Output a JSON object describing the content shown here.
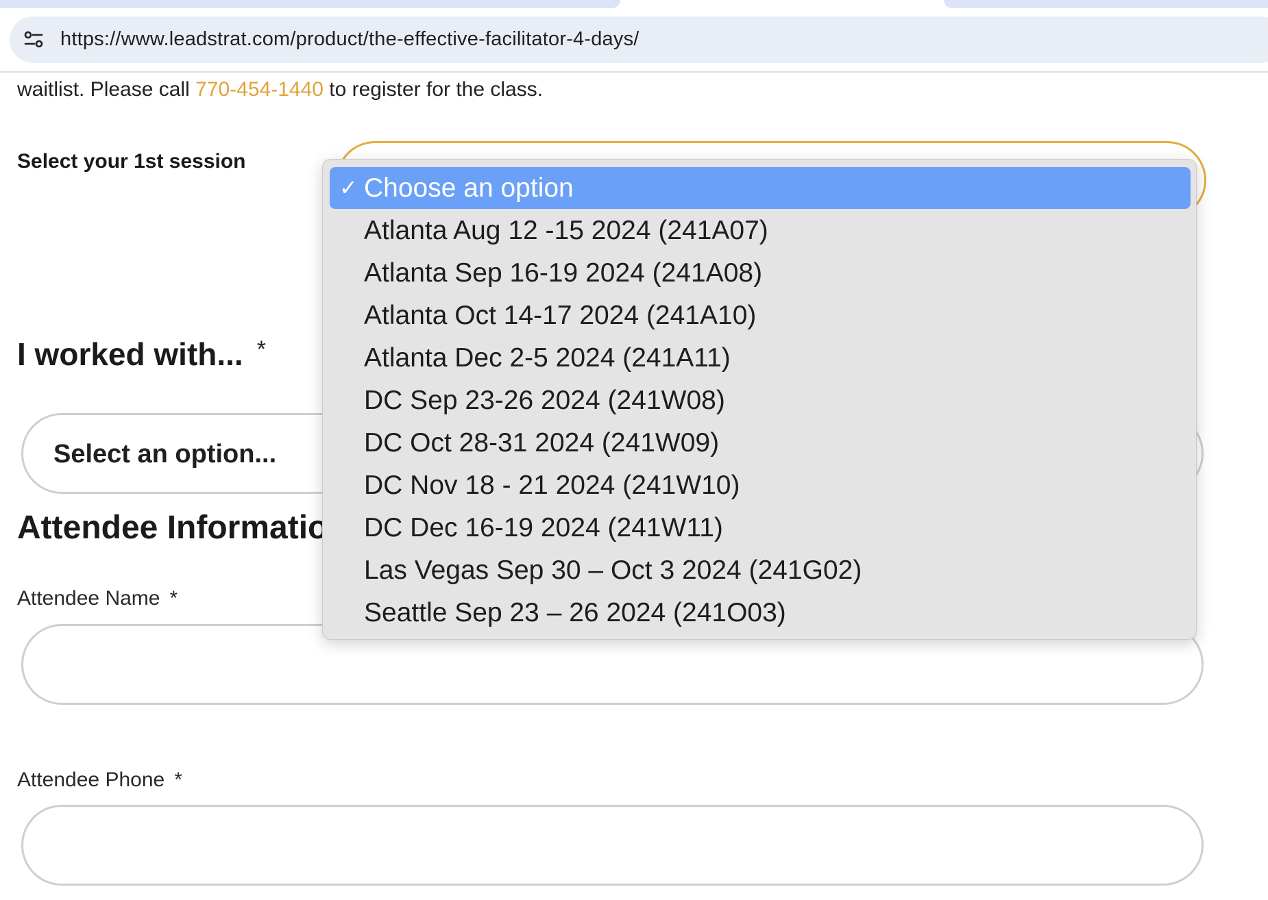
{
  "browser": {
    "url": "https://www.leadstrat.com/product/the-effective-facilitator-4-days/",
    "site_info_icon": "tune-icon"
  },
  "notice": {
    "before": "waitlist. Please call ",
    "phone": "770-454-1440",
    "after": " to register for the class.",
    "link_color": "#e0a33a"
  },
  "session": {
    "label": "Select your 1st session",
    "accent_color": "#e3ad3f",
    "dropdown": {
      "options": [
        "Choose an option",
        "Atlanta Aug 12 -15 2024 (241A07)",
        "Atlanta Sep 16-19 2024 (241A08)",
        "Atlanta Oct 14-17 2024 (241A10)",
        "Atlanta Dec 2-5 2024 (241A11)",
        "DC Sep 23-26 2024 (241W08)",
        "DC Oct 28-31 2024 (241W09)",
        "DC Nov 18 - 21 2024 (241W10)",
        "DC Dec 16-19 2024 (241W11)",
        "Las Vegas Sep 30 – Oct 3 2024 (241G02)",
        "Seattle Sep 23 – 26 2024 (241O03)"
      ],
      "selected_index": 0,
      "check_mark": "✓",
      "highlight_color": "#6aa0f8"
    }
  },
  "worked_with": {
    "heading": "I worked with...",
    "required": "*",
    "placeholder": "Select an option..."
  },
  "attendee": {
    "heading": "Attendee Information",
    "name_label": "Attendee Name",
    "phone_label": "Attendee Phone",
    "required": "*"
  }
}
